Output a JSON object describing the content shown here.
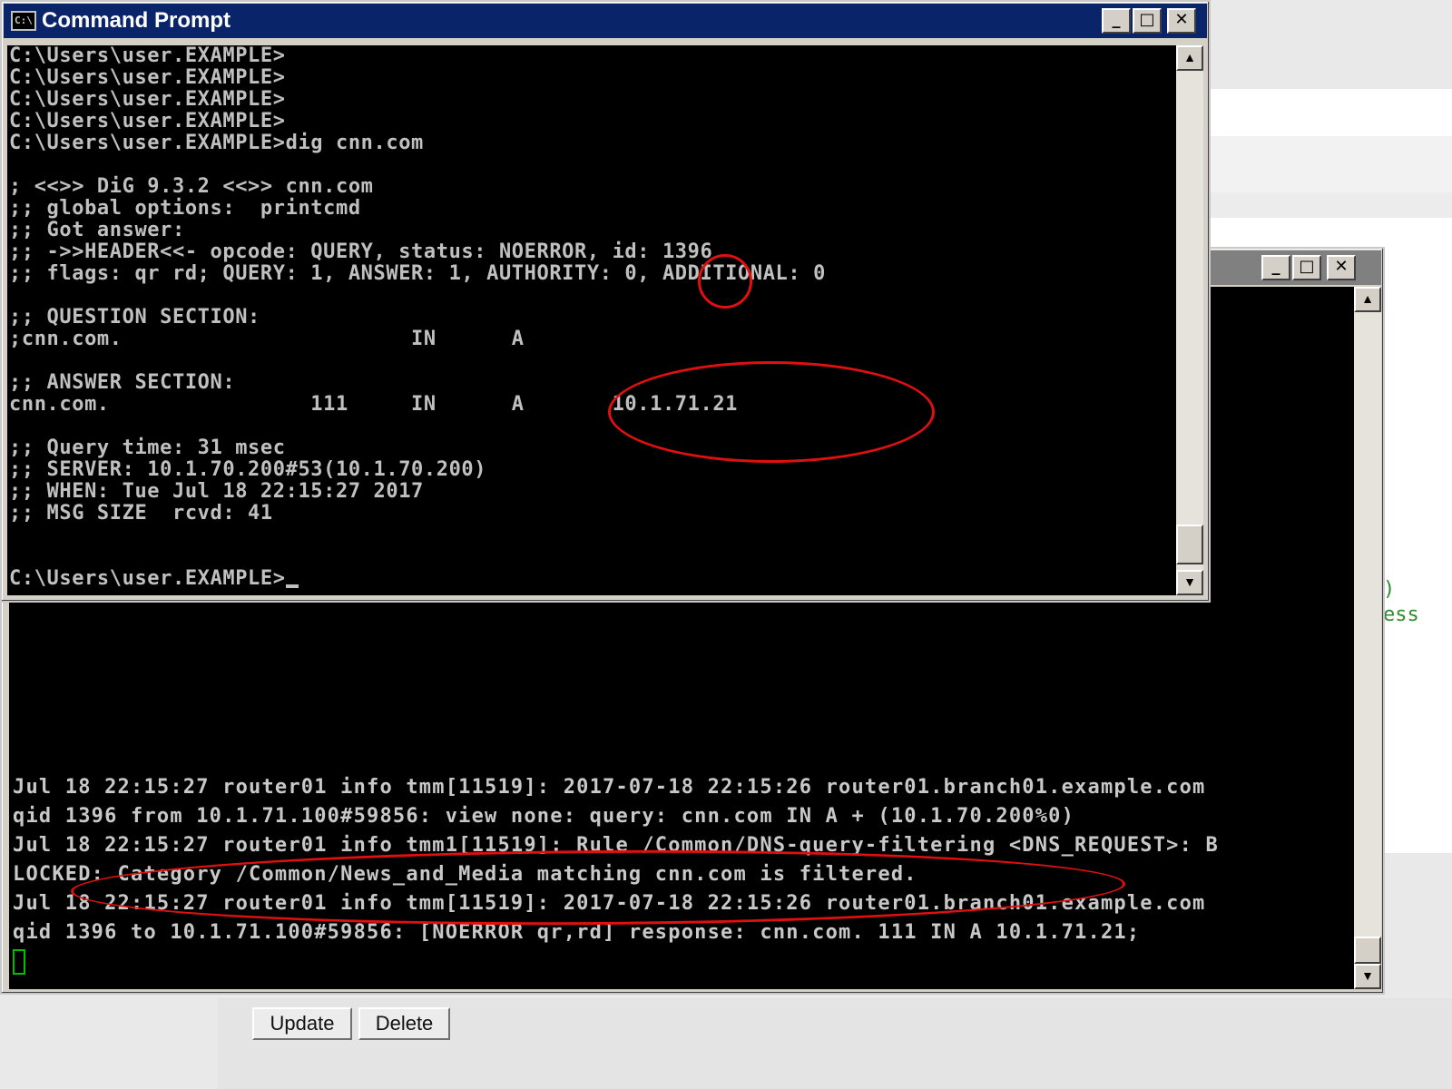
{
  "cmd_window": {
    "title": "Command Prompt",
    "icon_label": "C:\\",
    "lines": [
      "C:\\Users\\user.EXAMPLE>",
      "C:\\Users\\user.EXAMPLE>",
      "C:\\Users\\user.EXAMPLE>",
      "C:\\Users\\user.EXAMPLE>",
      "C:\\Users\\user.EXAMPLE>dig cnn.com",
      "",
      "; <<>> DiG 9.3.2 <<>> cnn.com",
      ";; global options:  printcmd",
      ";; Got answer:",
      ";; ->>HEADER<<- opcode: QUERY, status: NOERROR, id: 1396",
      ";; flags: qr rd; QUERY: 1, ANSWER: 1, AUTHORITY: 0, ADDITIONAL: 0",
      "",
      ";; QUESTION SECTION:",
      ";cnn.com.                       IN      A",
      "",
      ";; ANSWER SECTION:",
      "cnn.com.                111     IN      A       10.1.71.21",
      "",
      ";; Query time: 31 msec",
      ";; SERVER: 10.1.70.200#53(10.1.70.200)",
      ";; WHEN: Tue Jul 18 22:15:27 2017",
      ";; MSG SIZE  rcvd: 41",
      "",
      ""
    ],
    "prompt": "C:\\Users\\user.EXAMPLE>"
  },
  "log_window": {
    "lines": [
      "Jul 18 22:15:27 router01 info tmm[11519]: 2017-07-18 22:15:26 router01.branch01.example.com",
      "qid 1396 from 10.1.71.100#59856: view none: query: cnn.com IN A + (10.1.70.200%0)",
      "Jul 18 22:15:27 router01 info tmm1[11519]: Rule /Common/DNS-query-filtering <DNS_REQUEST>: B",
      "LOCKED: Category /Common/News_and_Media matching cnn.com is filtered.",
      "Jul 18 22:15:27 router01 info tmm[11519]: 2017-07-18 22:15:26 router01.branch01.example.com",
      "qid 1396 to 10.1.71.100#59856: [NOERROR qr,rd] response: cnn.com. 111 IN A 10.1.71.21;"
    ]
  },
  "window_controls": {
    "minimize": "_",
    "maximize": "□",
    "close": "✕"
  },
  "scroll": {
    "up": "▲",
    "down": "▼"
  },
  "background": {
    "partial_text_1": ")",
    "partial_text_2": "ess"
  },
  "form": {
    "update_label": "Update",
    "delete_label": "Delete"
  },
  "colors": {
    "annotation": "#e01010",
    "titlebar_active": "#0a246a",
    "console_bg": "#000000",
    "console_fg": "#c0c0c0"
  }
}
